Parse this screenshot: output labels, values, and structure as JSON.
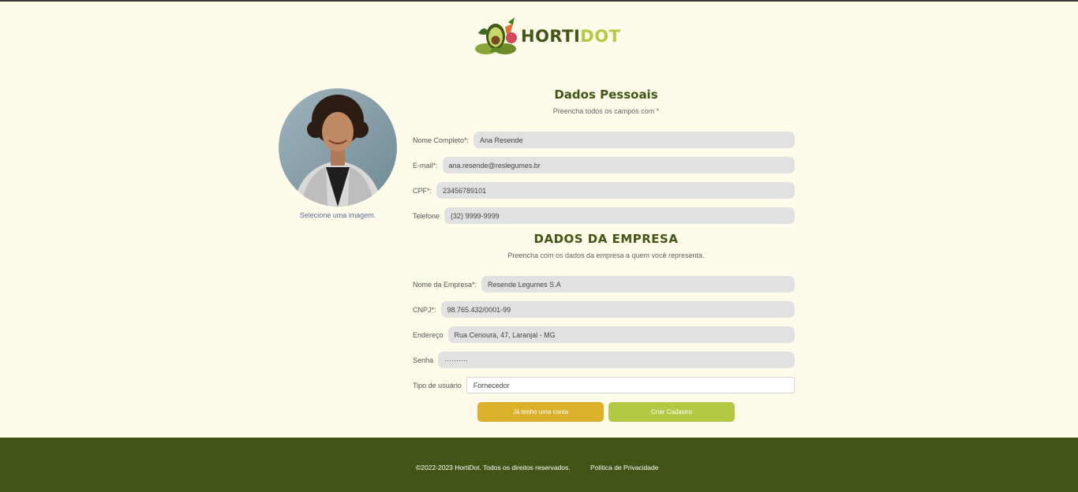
{
  "brand": {
    "name_part1": "HORTI",
    "name_part2": "DOT"
  },
  "personal": {
    "title": "Dados Pessoais",
    "subtitle": "Preencha todos os campos com *",
    "fields": [
      {
        "label": "Nome Completo*:",
        "value": "Ana Resende"
      },
      {
        "label": "E-mail*:",
        "value": "ana.resende@reslegumes.br"
      },
      {
        "label": "CPF*:",
        "value": "23456789101"
      },
      {
        "label": "Telefone",
        "value": "(32) 9999-9999"
      }
    ]
  },
  "avatar": {
    "link_label": "Selecione uma imagem."
  },
  "company": {
    "title": "DADOS DA EMPRESA",
    "subtitle": "Preencha com os dados da empresa a quem você representa.",
    "fields": [
      {
        "label": "Nome da Empresa*:",
        "value": "Resende Legumes S.A"
      },
      {
        "label": "CNPJ*:",
        "value": "98.765.432/0001-99"
      },
      {
        "label": "Endereço",
        "value": "Rua Cenoura, 47,  Laranjal - MG"
      },
      {
        "label": "Senha",
        "value": "··········"
      },
      {
        "label": "Tipo de usuário",
        "value": "Fornecedor"
      }
    ]
  },
  "buttons": {
    "login": "Já tenho uma conta",
    "create": "Criar Cadastro"
  },
  "footer": {
    "copyright": "©2022-2023 HortiDot. Todos os direitos reservados.",
    "privacy": "Política de Privacidade"
  },
  "colors": {
    "background": "#fefbea",
    "brand_dark": "#435417",
    "brand_light": "#b3c843",
    "button_yellow": "#dbb02a",
    "input_bg": "#e1e1e1"
  }
}
